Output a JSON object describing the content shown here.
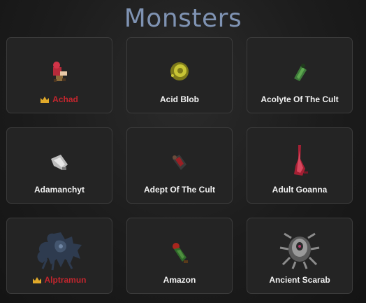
{
  "page": {
    "title": "Monsters"
  },
  "monsters": [
    {
      "name": "Achad",
      "boss": true,
      "icon": "achad-sprite"
    },
    {
      "name": "Acid Blob",
      "boss": false,
      "icon": "acid-blob-sprite"
    },
    {
      "name": "Acolyte Of The Cult",
      "boss": false,
      "icon": "acolyte-sprite"
    },
    {
      "name": "Adamanchyt",
      "boss": false,
      "icon": "adamanchyt-sprite"
    },
    {
      "name": "Adept Of The Cult",
      "boss": false,
      "icon": "adept-sprite"
    },
    {
      "name": "Adult Goanna",
      "boss": false,
      "icon": "goanna-sprite"
    },
    {
      "name": "Alptramun",
      "boss": true,
      "icon": "alptramun-sprite"
    },
    {
      "name": "Amazon",
      "boss": false,
      "icon": "amazon-sprite"
    },
    {
      "name": "Ancient Scarab",
      "boss": false,
      "icon": "scarab-sprite"
    }
  ],
  "colors": {
    "title": "#7f93b3",
    "boss_name": "#c2262e",
    "name": "#f2f2f2",
    "card_bg": "#242424"
  }
}
